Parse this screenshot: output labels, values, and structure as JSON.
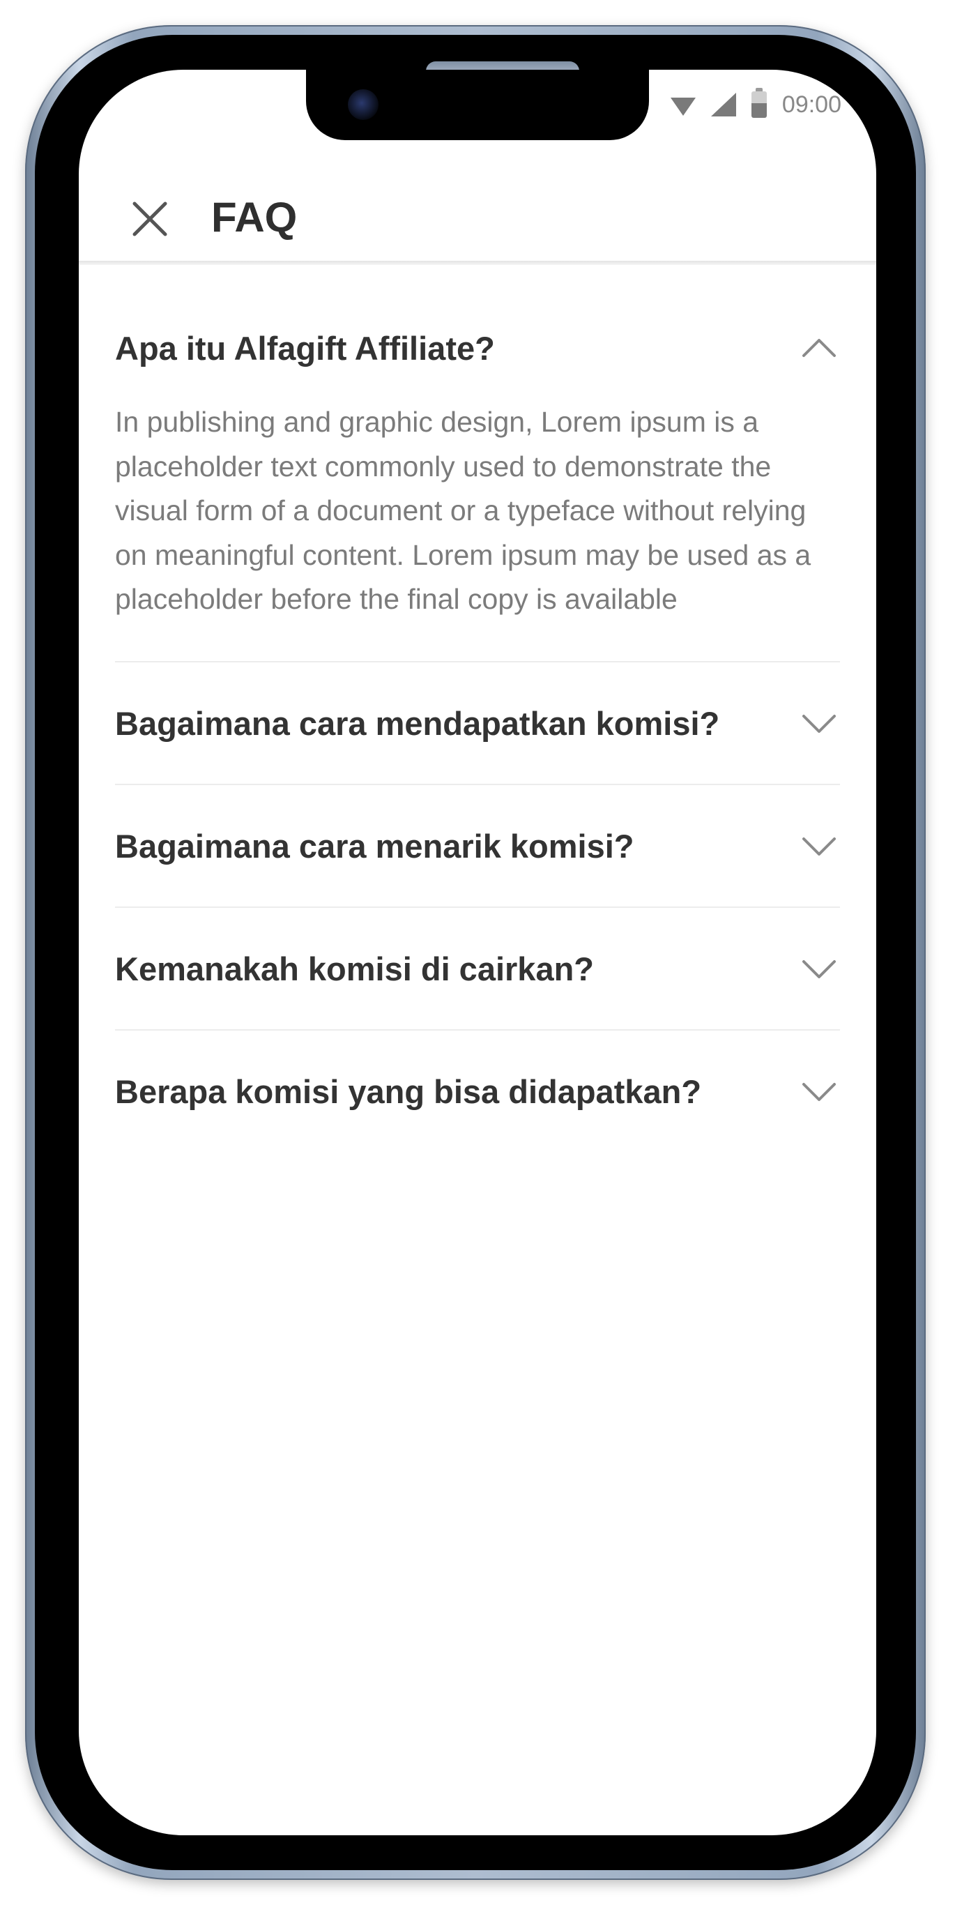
{
  "status_bar": {
    "time": "09:00",
    "icons": [
      "wifi-icon",
      "signal-icon",
      "battery-icon"
    ]
  },
  "app_bar": {
    "title": "FAQ",
    "close_icon": "close-icon"
  },
  "faq": {
    "items": [
      {
        "question": "Apa itu Alfagift Affiliate?",
        "expanded": true,
        "answer": "In publishing and graphic design, Lorem ipsum is a placeholder text commonly used to demonstrate the visual form of a document or a typeface without relying on meaningful content. Lorem ipsum may be used as a placeholder before the final copy is available"
      },
      {
        "question": "Bagaimana cara mendapatkan komisi?",
        "expanded": false
      },
      {
        "question": "Bagaimana cara menarik komisi?",
        "expanded": false
      },
      {
        "question": "Kemanakah komisi di cairkan?",
        "expanded": false
      },
      {
        "question": "Berapa komisi yang bisa didapatkan?",
        "expanded": false
      }
    ]
  },
  "colors": {
    "title_text": "#2f2f2f",
    "question_text": "#333333",
    "answer_text": "#7b7b7b",
    "divider": "#ececec",
    "icon": "#7a7a7a",
    "frame": "#aebdd0"
  }
}
